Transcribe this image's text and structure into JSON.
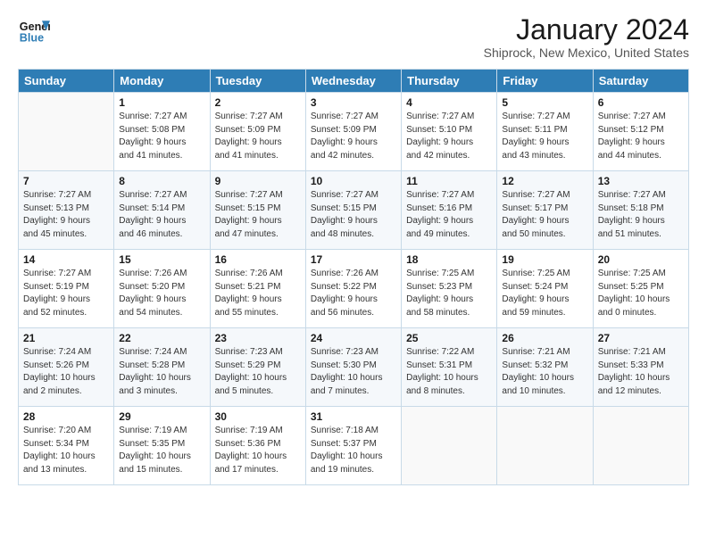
{
  "header": {
    "logo_line1": "General",
    "logo_line2": "Blue",
    "title": "January 2024",
    "subtitle": "Shiprock, New Mexico, United States"
  },
  "days_of_week": [
    "Sunday",
    "Monday",
    "Tuesday",
    "Wednesday",
    "Thursday",
    "Friday",
    "Saturday"
  ],
  "weeks": [
    [
      {
        "day": "",
        "text": ""
      },
      {
        "day": "1",
        "text": "Sunrise: 7:27 AM\nSunset: 5:08 PM\nDaylight: 9 hours\nand 41 minutes."
      },
      {
        "day": "2",
        "text": "Sunrise: 7:27 AM\nSunset: 5:09 PM\nDaylight: 9 hours\nand 41 minutes."
      },
      {
        "day": "3",
        "text": "Sunrise: 7:27 AM\nSunset: 5:09 PM\nDaylight: 9 hours\nand 42 minutes."
      },
      {
        "day": "4",
        "text": "Sunrise: 7:27 AM\nSunset: 5:10 PM\nDaylight: 9 hours\nand 42 minutes."
      },
      {
        "day": "5",
        "text": "Sunrise: 7:27 AM\nSunset: 5:11 PM\nDaylight: 9 hours\nand 43 minutes."
      },
      {
        "day": "6",
        "text": "Sunrise: 7:27 AM\nSunset: 5:12 PM\nDaylight: 9 hours\nand 44 minutes."
      }
    ],
    [
      {
        "day": "7",
        "text": "Sunrise: 7:27 AM\nSunset: 5:13 PM\nDaylight: 9 hours\nand 45 minutes."
      },
      {
        "day": "8",
        "text": "Sunrise: 7:27 AM\nSunset: 5:14 PM\nDaylight: 9 hours\nand 46 minutes."
      },
      {
        "day": "9",
        "text": "Sunrise: 7:27 AM\nSunset: 5:15 PM\nDaylight: 9 hours\nand 47 minutes."
      },
      {
        "day": "10",
        "text": "Sunrise: 7:27 AM\nSunset: 5:15 PM\nDaylight: 9 hours\nand 48 minutes."
      },
      {
        "day": "11",
        "text": "Sunrise: 7:27 AM\nSunset: 5:16 PM\nDaylight: 9 hours\nand 49 minutes."
      },
      {
        "day": "12",
        "text": "Sunrise: 7:27 AM\nSunset: 5:17 PM\nDaylight: 9 hours\nand 50 minutes."
      },
      {
        "day": "13",
        "text": "Sunrise: 7:27 AM\nSunset: 5:18 PM\nDaylight: 9 hours\nand 51 minutes."
      }
    ],
    [
      {
        "day": "14",
        "text": "Sunrise: 7:27 AM\nSunset: 5:19 PM\nDaylight: 9 hours\nand 52 minutes."
      },
      {
        "day": "15",
        "text": "Sunrise: 7:26 AM\nSunset: 5:20 PM\nDaylight: 9 hours\nand 54 minutes."
      },
      {
        "day": "16",
        "text": "Sunrise: 7:26 AM\nSunset: 5:21 PM\nDaylight: 9 hours\nand 55 minutes."
      },
      {
        "day": "17",
        "text": "Sunrise: 7:26 AM\nSunset: 5:22 PM\nDaylight: 9 hours\nand 56 minutes."
      },
      {
        "day": "18",
        "text": "Sunrise: 7:25 AM\nSunset: 5:23 PM\nDaylight: 9 hours\nand 58 minutes."
      },
      {
        "day": "19",
        "text": "Sunrise: 7:25 AM\nSunset: 5:24 PM\nDaylight: 9 hours\nand 59 minutes."
      },
      {
        "day": "20",
        "text": "Sunrise: 7:25 AM\nSunset: 5:25 PM\nDaylight: 10 hours\nand 0 minutes."
      }
    ],
    [
      {
        "day": "21",
        "text": "Sunrise: 7:24 AM\nSunset: 5:26 PM\nDaylight: 10 hours\nand 2 minutes."
      },
      {
        "day": "22",
        "text": "Sunrise: 7:24 AM\nSunset: 5:28 PM\nDaylight: 10 hours\nand 3 minutes."
      },
      {
        "day": "23",
        "text": "Sunrise: 7:23 AM\nSunset: 5:29 PM\nDaylight: 10 hours\nand 5 minutes."
      },
      {
        "day": "24",
        "text": "Sunrise: 7:23 AM\nSunset: 5:30 PM\nDaylight: 10 hours\nand 7 minutes."
      },
      {
        "day": "25",
        "text": "Sunrise: 7:22 AM\nSunset: 5:31 PM\nDaylight: 10 hours\nand 8 minutes."
      },
      {
        "day": "26",
        "text": "Sunrise: 7:21 AM\nSunset: 5:32 PM\nDaylight: 10 hours\nand 10 minutes."
      },
      {
        "day": "27",
        "text": "Sunrise: 7:21 AM\nSunset: 5:33 PM\nDaylight: 10 hours\nand 12 minutes."
      }
    ],
    [
      {
        "day": "28",
        "text": "Sunrise: 7:20 AM\nSunset: 5:34 PM\nDaylight: 10 hours\nand 13 minutes."
      },
      {
        "day": "29",
        "text": "Sunrise: 7:19 AM\nSunset: 5:35 PM\nDaylight: 10 hours\nand 15 minutes."
      },
      {
        "day": "30",
        "text": "Sunrise: 7:19 AM\nSunset: 5:36 PM\nDaylight: 10 hours\nand 17 minutes."
      },
      {
        "day": "31",
        "text": "Sunrise: 7:18 AM\nSunset: 5:37 PM\nDaylight: 10 hours\nand 19 minutes."
      },
      {
        "day": "",
        "text": ""
      },
      {
        "day": "",
        "text": ""
      },
      {
        "day": "",
        "text": ""
      }
    ]
  ]
}
